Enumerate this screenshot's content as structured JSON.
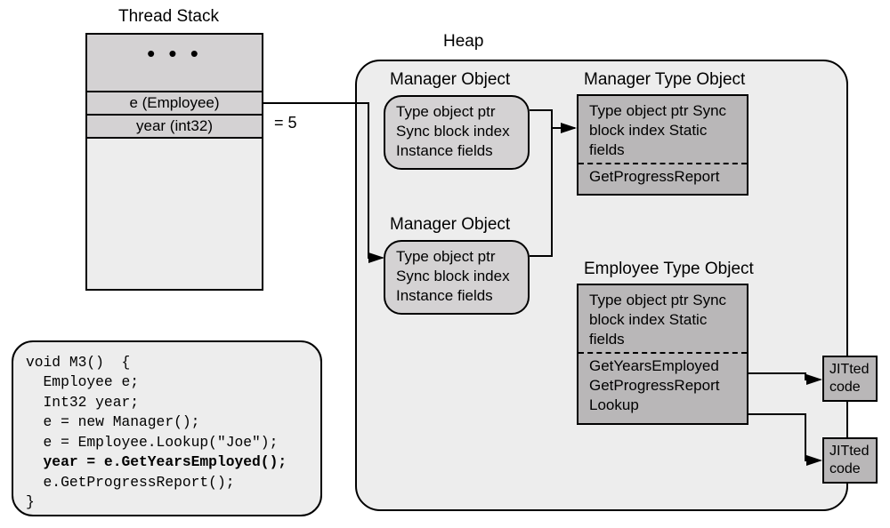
{
  "labels": {
    "threadStack": "Thread Stack",
    "heap": "Heap",
    "managerObject": "Manager Object",
    "managerTypeObject": "Manager Type Object",
    "employeeTypeObject": "Employee Type Object"
  },
  "stack": {
    "dots": "• • •",
    "row_e": "e (Employee)",
    "row_year": "year (int32)",
    "eq5": "=   5"
  },
  "mgrObj1": {
    "l1": "Type object ptr",
    "l2": "Sync block index",
    "l3": "Instance fields"
  },
  "mgrObj2": {
    "l1": "Type object ptr",
    "l2": "Sync block index",
    "l3": "Instance fields"
  },
  "mgrType": {
    "l1": "Type object ptr",
    "l2": "Sync block index",
    "l3": "Static fields",
    "m1": "GetProgressReport"
  },
  "empType": {
    "l1": "Type object ptr",
    "l2": "Sync block index",
    "l3": "Static fields",
    "m1": "GetYearsEmployed",
    "m2": "GetProgressReport",
    "m3": "Lookup"
  },
  "jitted": {
    "l1": "JITted",
    "l2": "code"
  },
  "code": {
    "l1": "void M3()  {",
    "l2": "  Employee e;",
    "l3": "  Int32 year;",
    "l4": "  e = new Manager();",
    "l5": "  e = Employee.Lookup(\"Joe\");",
    "l6": "  year = e.GetYearsEmployed();",
    "l7": "  e.GetProgressReport();",
    "l8": "}"
  }
}
